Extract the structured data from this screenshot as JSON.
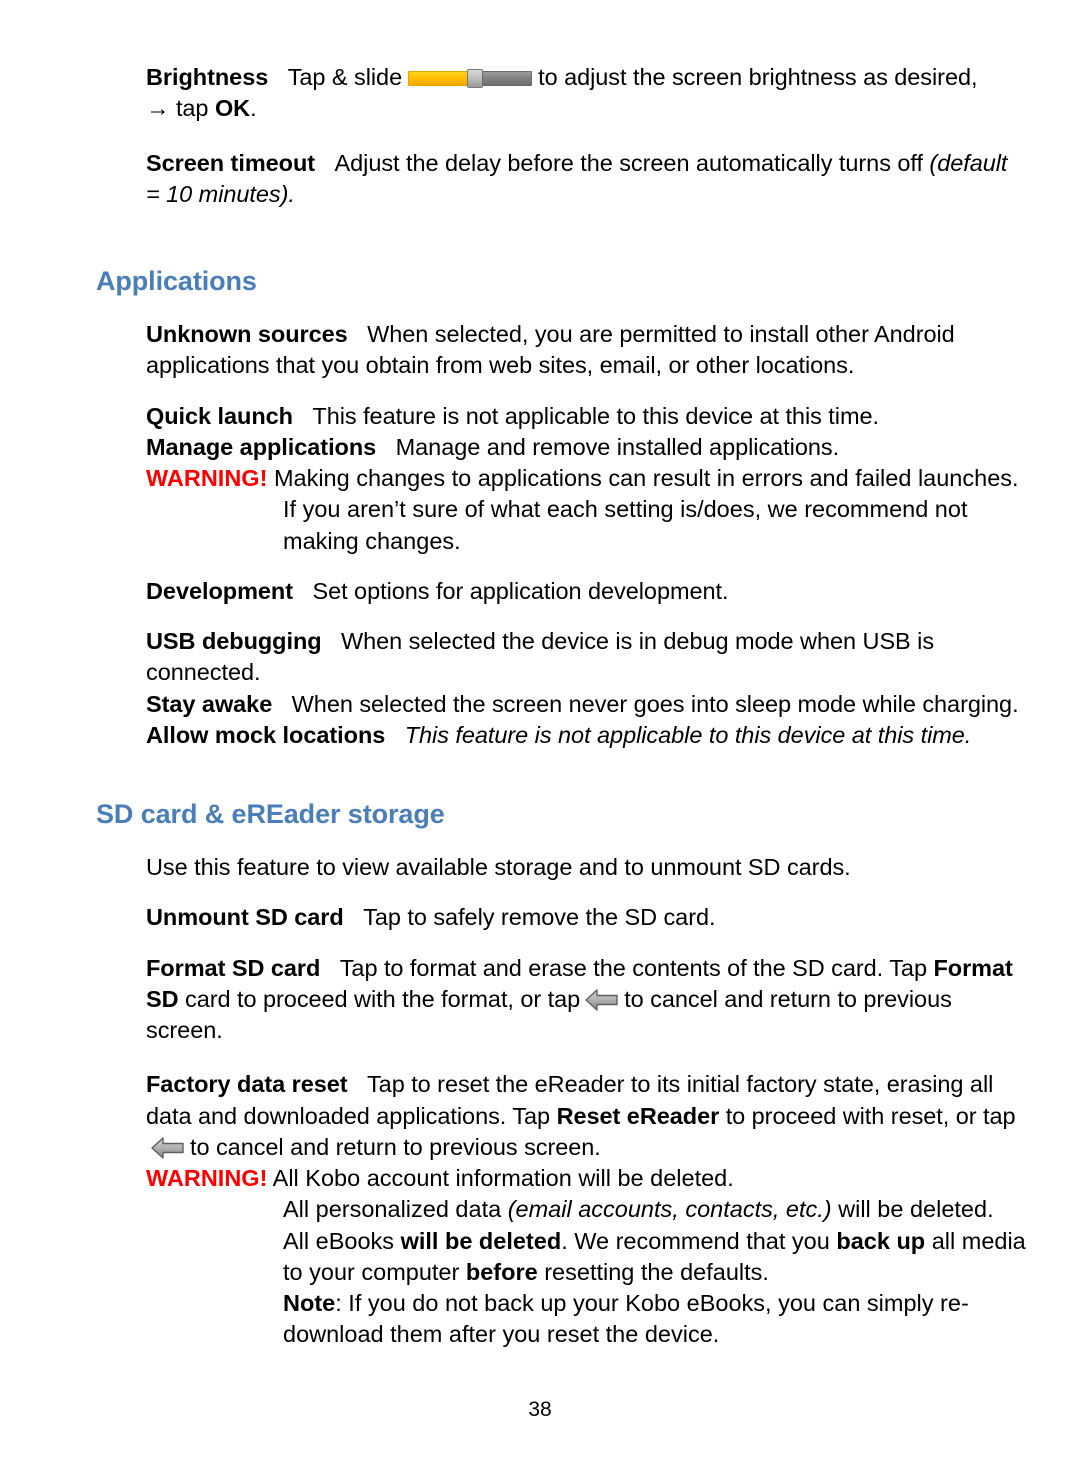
{
  "document": {
    "page_number": "38",
    "heading_color": "#4a7ebb",
    "warning_color": "#ff0000"
  },
  "display_section": {
    "brightness": {
      "term": "Brightness",
      "text_before_slider": "Tap & slide",
      "slider_icon": "brightness-slider-icon",
      "slider_fill_color": "#ffc000",
      "slider_track_color": "#7f7f7f",
      "text_after_slider": "to adjust the screen brightness as desired,",
      "second_line_arrow": "→",
      "second_line_before": "tap",
      "second_line_bold": "OK",
      "second_line_after": "."
    },
    "screen_timeout": {
      "term": "Screen timeout",
      "text": "Adjust the delay before the screen automatically turns off",
      "italic_tail": "(default = 10 minutes)."
    }
  },
  "applications_section": {
    "heading": "Applications",
    "unknown_sources": {
      "term": "Unknown sources",
      "text": "When selected, you are permitted to install other Android applications that you obtain from web sites, email, or other locations."
    },
    "quick_launch": {
      "term": "Quick launch",
      "text": "This feature is not applicable to this device at this time."
    },
    "manage_applications": {
      "term": "Manage applications",
      "text": "Manage and remove installed applications."
    },
    "warning": {
      "label": "WARNING!",
      "text": "Making changes to applications can result in errors and failed launches. If you aren’t sure of what each setting is/does, we recommend not making changes."
    },
    "development": {
      "term": "Development",
      "text": "Set options for application development."
    },
    "usb_debugging": {
      "term": "USB debugging",
      "text": "When selected the device is in debug mode when USB is connected."
    },
    "stay_awake": {
      "term": "Stay awake",
      "text": "When selected the screen never goes into sleep mode while charging."
    },
    "allow_mock_locations": {
      "term": "Allow mock locations",
      "italic_text": "This feature is not applicable to this device at this time."
    }
  },
  "sd_card_section": {
    "heading": "SD card & eREader storage",
    "intro": "Use this feature to view available storage and to unmount SD cards.",
    "unmount_sd_card": {
      "term": "Unmount SD card",
      "text": "Tap to safely remove the SD card."
    },
    "format_sd_card": {
      "term": "Format SD card",
      "text_part1": "Tap to format and erase the contents of the SD card. Tap",
      "bold_inline": "Format SD",
      "text_part2": "card to proceed with the format, or tap",
      "back_arrow_icon": "back-arrow-icon",
      "text_part3": "to cancel and return to previous screen."
    },
    "factory_data_reset": {
      "term": "Factory data reset",
      "text_part1": "Tap to reset the eReader to its initial factory state, erasing all data and downloaded applications. Tap",
      "bold_inline": "Reset eReader",
      "text_part2": "to proceed with reset, or tap",
      "back_arrow_icon": "back-arrow-icon",
      "text_part3": "to cancel and return to previous screen."
    },
    "warning": {
      "label": "WARNING!",
      "line1": "All Kobo account information will be deleted.",
      "line2_part1": "All personalized data",
      "line2_italic": "(email accounts, contacts, etc.)",
      "line2_part2": "will be deleted.",
      "line3_part1": "All eBooks",
      "line3_bold1": "will be deleted",
      "line3_part2": ". We recommend that you",
      "line3_bold2": "back up",
      "line3_part3": "all media to your computer",
      "line3_bold3": "before",
      "line3_part4": "resetting the defaults.",
      "line4_bold": "Note",
      "line4_text": ": If you do not back up your Kobo eBooks, you can simply re-download them after you reset the device."
    }
  }
}
